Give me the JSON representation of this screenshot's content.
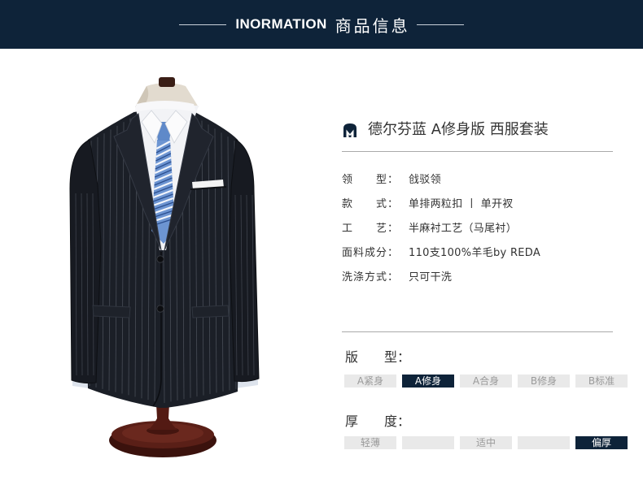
{
  "banner": {
    "title_en": "INORMATION",
    "title_cn": "商品信息"
  },
  "product": {
    "logo_icon": "brand-logo-icon",
    "name": "德尔芬蓝 A修身版 西服套装"
  },
  "specs": [
    {
      "label": "领　　型：",
      "value": "戗驳领"
    },
    {
      "label": "款　　式：",
      "value": "单排两粒扣 丨 单开衩"
    },
    {
      "label": "工　　艺：",
      "value": "半麻衬工艺（马尾衬）"
    },
    {
      "label": "面料成分：",
      "value": "110支100%羊毛by REDA"
    },
    {
      "label": "洗涤方式：",
      "value": "只可干洗"
    }
  ],
  "fit": {
    "label": "版　　型：",
    "options": [
      {
        "label": "A紧身",
        "selected": false
      },
      {
        "label": "A修身",
        "selected": true
      },
      {
        "label": "A合身",
        "selected": false
      },
      {
        "label": "B修身",
        "selected": false
      },
      {
        "label": "B标准",
        "selected": false
      }
    ]
  },
  "thickness": {
    "label": "厚　　度：",
    "options": [
      {
        "label": "轻薄",
        "selected": false
      },
      {
        "label": "",
        "selected": false
      },
      {
        "label": "适中",
        "selected": false
      },
      {
        "label": "",
        "selected": false
      },
      {
        "label": "偏厚",
        "selected": true
      }
    ]
  },
  "colors": {
    "banner_bg": "#0e2339",
    "banner_text": "#ffffff",
    "rule": "#a9a9a9",
    "text": "#333333",
    "option_bg": "#e9e9e9",
    "option_text": "#9a9a9a",
    "selected_bg": "#0e2339",
    "selected_text": "#ffffff"
  }
}
